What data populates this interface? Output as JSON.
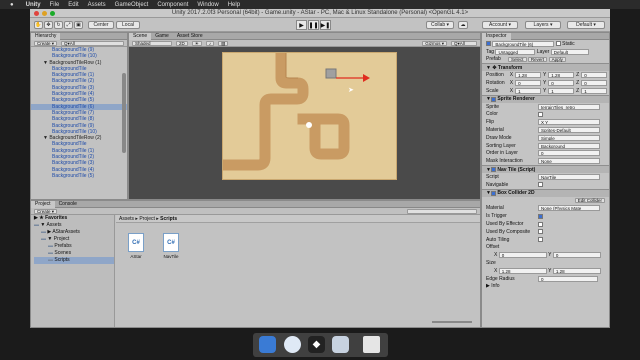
{
  "menu": {
    "apple": "",
    "app": "Unity",
    "items": [
      "File",
      "Edit",
      "Assets",
      "GameObject",
      "Component",
      "Window",
      "Help"
    ]
  },
  "window_title": "Unity 2017.2.0f3 Personal (64bit) - Game.unity - AStar - PC, Mac & Linux Standalone (Personal) <OpenGL 4.1>",
  "toolbar": {
    "center": "Center",
    "local": "Local",
    "collab": "Collab ▾",
    "account": "Account ▾",
    "layers": "Layers ▾",
    "layout": "Default ▾"
  },
  "hierarchy": {
    "tab": "Hierarchy",
    "create": "Create ▾",
    "search": "Q▾All",
    "items": [
      {
        "label": "BackgroundTile (9)",
        "indent": 2,
        "sel": false,
        "parent": false
      },
      {
        "label": "BackgroundTile (10)",
        "indent": 2,
        "sel": false,
        "parent": false
      },
      {
        "label": "▼ BackgroundTileRow (1)",
        "indent": 1,
        "sel": false,
        "parent": true
      },
      {
        "label": "BackgroundTile",
        "indent": 2,
        "sel": false,
        "parent": false
      },
      {
        "label": "BackgroundTile (1)",
        "indent": 2,
        "sel": false,
        "parent": false
      },
      {
        "label": "BackgroundTile (2)",
        "indent": 2,
        "sel": false,
        "parent": false
      },
      {
        "label": "BackgroundTile (3)",
        "indent": 2,
        "sel": false,
        "parent": false
      },
      {
        "label": "BackgroundTile (4)",
        "indent": 2,
        "sel": false,
        "parent": false
      },
      {
        "label": "BackgroundTile (5)",
        "indent": 2,
        "sel": false,
        "parent": false
      },
      {
        "label": "BackgroundTile (6)",
        "indent": 2,
        "sel": true,
        "parent": false
      },
      {
        "label": "BackgroundTile (7)",
        "indent": 2,
        "sel": false,
        "parent": false
      },
      {
        "label": "BackgroundTile (8)",
        "indent": 2,
        "sel": false,
        "parent": false
      },
      {
        "label": "BackgroundTile (9)",
        "indent": 2,
        "sel": false,
        "parent": false
      },
      {
        "label": "BackgroundTile (10)",
        "indent": 2,
        "sel": false,
        "parent": false
      },
      {
        "label": "▼ BackgroundTileRow (2)",
        "indent": 1,
        "sel": false,
        "parent": true
      },
      {
        "label": "BackgroundTile",
        "indent": 2,
        "sel": false,
        "parent": false
      },
      {
        "label": "BackgroundTile (1)",
        "indent": 2,
        "sel": false,
        "parent": false
      },
      {
        "label": "BackgroundTile (2)",
        "indent": 2,
        "sel": false,
        "parent": false
      },
      {
        "label": "BackgroundTile (3)",
        "indent": 2,
        "sel": false,
        "parent": false
      },
      {
        "label": "BackgroundTile (4)",
        "indent": 2,
        "sel": false,
        "parent": false
      },
      {
        "label": "BackgroundTile (5)",
        "indent": 2,
        "sel": false,
        "parent": false
      }
    ]
  },
  "scene": {
    "tabs": [
      "Scene",
      "Game",
      "Asset Store"
    ],
    "shading": "Shaded",
    "mode2d": "2D",
    "gizmos": "Gizmos ▾",
    "search": "Q▾All"
  },
  "inspector": {
    "tab": "Inspector",
    "object_name": "BackgroundTile (6)",
    "static": "Static",
    "tag_label": "Tag",
    "tag": "Untagged",
    "layer_label": "Layer",
    "layer": "Default",
    "prefab_label": "Prefab",
    "select": "Select",
    "revert": "Revert",
    "apply": "Apply",
    "transform": {
      "title": "Transform",
      "rows": [
        {
          "label": "Position",
          "x": "1.28",
          "y": "1.28",
          "z": "0"
        },
        {
          "label": "Rotation",
          "x": "0",
          "y": "0",
          "z": "0"
        },
        {
          "label": "Scale",
          "x": "1",
          "y": "1",
          "z": "1"
        }
      ]
    },
    "sprite_renderer": {
      "title": "Sprite Renderer",
      "rows": [
        {
          "label": "Sprite",
          "value": "terrainTiles_retro"
        },
        {
          "label": "Color",
          "value": ""
        },
        {
          "label": "Flip",
          "value": "X  Y"
        },
        {
          "label": "Material",
          "value": "Sprites-Default"
        },
        {
          "label": "Draw Mode",
          "value": "Simple"
        },
        {
          "label": "Sorting Layer",
          "value": "Background"
        },
        {
          "label": "Order in Layer",
          "value": "0"
        },
        {
          "label": "Mask Interaction",
          "value": "None"
        }
      ]
    },
    "nav_tile": {
      "title": "Nav Tile (Script)",
      "rows": [
        {
          "label": "Script",
          "value": "NavTile"
        },
        {
          "label": "Navigable",
          "value": ""
        }
      ]
    },
    "box_collider": {
      "title": "Box Collider 2D",
      "edit": "Edit Collider",
      "rows": [
        {
          "label": "Material",
          "value": "None (Physics Mate"
        },
        {
          "label": "Is Trigger",
          "value": ""
        },
        {
          "label": "Used By Effector",
          "value": ""
        },
        {
          "label": "Used By Composite",
          "value": ""
        },
        {
          "label": "Auto Tiling",
          "value": ""
        }
      ],
      "offset_label": "Offset",
      "offset_x": "0",
      "offset_y": "0",
      "size_label": "Size",
      "size_x": "1.28",
      "size_y": "1.28",
      "edge_label": "Edge Radius",
      "edge": "0",
      "info": "Info"
    }
  },
  "project": {
    "tabs": [
      "Project",
      "Console"
    ],
    "create": "Create ▾",
    "favorites": "Favorites",
    "tree": [
      {
        "label": "▼ Assets",
        "indent": 0
      },
      {
        "label": "▶ AStarAssets",
        "indent": 1
      },
      {
        "label": "▼ Project",
        "indent": 1
      },
      {
        "label": "Prefabs",
        "indent": 2
      },
      {
        "label": "Scenes",
        "indent": 2
      },
      {
        "label": "Scripts",
        "indent": 2
      }
    ],
    "breadcrumb": [
      "Assets",
      "Project",
      "Scripts"
    ],
    "files": [
      {
        "name": "AStar"
      },
      {
        "name": "NavTile"
      }
    ]
  },
  "colors": {
    "path": "#c99b63",
    "sand": "#e3cb98",
    "arrow": "#e02d1f",
    "selection": "#8fa6c8",
    "panel": "#c2c2c2"
  }
}
